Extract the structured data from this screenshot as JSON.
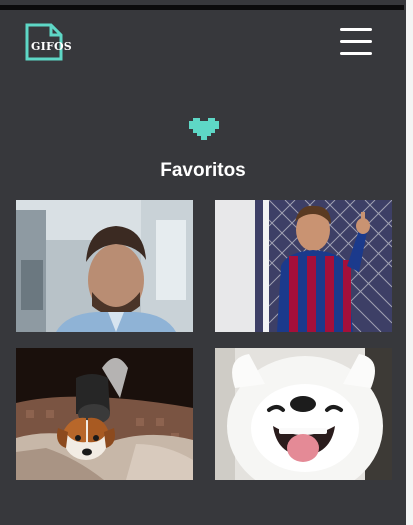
{
  "header": {
    "logo_text": "GIFOS",
    "menu_icon": "hamburger-menu-icon"
  },
  "favorites": {
    "icon": "heart-icon",
    "title": "Favoritos",
    "gifs": [
      {
        "subject": "man-in-office"
      },
      {
        "subject": "soccer-player-thumbs-up"
      },
      {
        "subject": "puppy-under-blanket"
      },
      {
        "subject": "smiling-white-dog"
      }
    ]
  },
  "colors": {
    "background": "#37383c",
    "accent": "#5ed7c6",
    "text": "#ffffff"
  }
}
